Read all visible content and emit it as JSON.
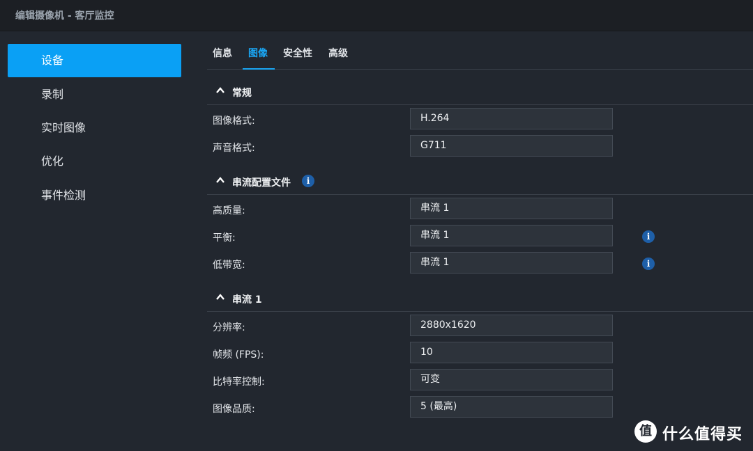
{
  "window": {
    "title": "编辑摄像机 - 客厅监控"
  },
  "sidebar": {
    "items": [
      {
        "label": "设备",
        "active": true
      },
      {
        "label": "录制"
      },
      {
        "label": "实时图像"
      },
      {
        "label": "优化"
      },
      {
        "label": "事件检测"
      }
    ]
  },
  "tabs": [
    {
      "label": "信息"
    },
    {
      "label": "图像",
      "active": true
    },
    {
      "label": "安全性"
    },
    {
      "label": "高级"
    }
  ],
  "sections": {
    "general": {
      "title": "常规",
      "rows": [
        {
          "label": "图像格式:",
          "value": "H.264"
        },
        {
          "label": "声音格式:",
          "value": "G711"
        }
      ]
    },
    "stream_profile": {
      "title": "串流配置文件",
      "rows": [
        {
          "label": "高质量:",
          "value": "串流 1"
        },
        {
          "label": "平衡:",
          "value": "串流 1"
        },
        {
          "label": "低带宽:",
          "value": "串流 1"
        }
      ]
    },
    "stream1": {
      "title": "串流 1",
      "rows": [
        {
          "label": "分辨率:",
          "value": "2880x1620"
        },
        {
          "label": "帧频 (FPS):",
          "value": "10"
        },
        {
          "label": "比特率控制:",
          "value": "可变"
        },
        {
          "label": "图像品质:",
          "value": "5 (最高)"
        }
      ]
    }
  },
  "watermark": {
    "logo": "值",
    "brand": "什么值得买"
  },
  "colors": {
    "accent": "#0aa0f5",
    "background": "#22272f",
    "info": "#1e5fa8"
  }
}
